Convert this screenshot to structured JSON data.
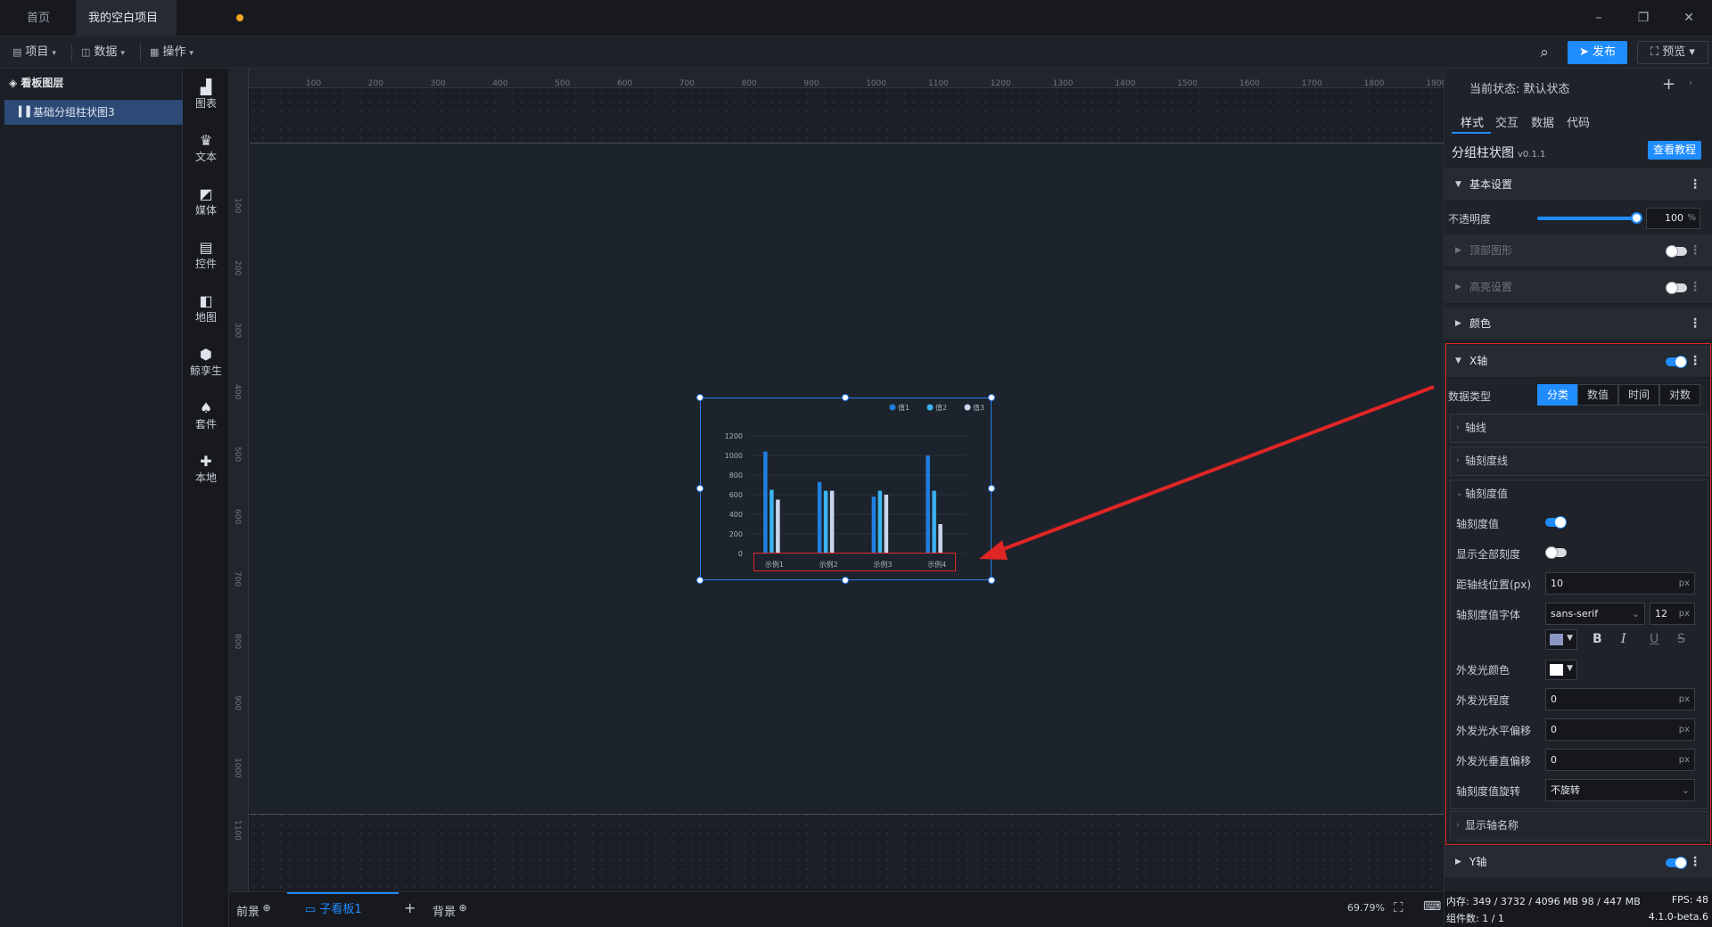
{
  "tabs": {
    "home": "首页",
    "project": "我的空白项目"
  },
  "menubar": {
    "project": "项目",
    "data": "数据",
    "operation": "操作",
    "publish": "发布",
    "preview": "预览"
  },
  "layers": {
    "title": "看板图层",
    "item": "基础分组柱状图3"
  },
  "toolbox": [
    "图表",
    "文本",
    "媒体",
    "控件",
    "地图",
    "鲸孪生",
    "套件",
    "本地"
  ],
  "ruler": {
    "top": [
      "100",
      "200",
      "300",
      "400",
      "500",
      "600",
      "700",
      "800",
      "900",
      "1000",
      "1100",
      "1200",
      "1300",
      "1400",
      "1500",
      "1600",
      "1700",
      "1800",
      "1900"
    ],
    "left": [
      "100",
      "200",
      "300",
      "400",
      "500",
      "600",
      "700",
      "800",
      "900",
      "1000",
      "1100"
    ]
  },
  "chart_data": {
    "type": "bar",
    "categories": [
      "示例1",
      "示例2",
      "示例3",
      "示例4"
    ],
    "series": [
      {
        "name": "值1",
        "values": [
          1040,
          730,
          580,
          1000
        ],
        "color": "#1f7fe0"
      },
      {
        "name": "值2",
        "values": [
          650,
          640,
          640,
          640
        ],
        "color": "#3bb3f0"
      },
      {
        "name": "值3",
        "values": [
          550,
          640,
          600,
          300
        ],
        "color": "#c9d6ee"
      }
    ],
    "ylim": [
      0,
      1200
    ],
    "yticks": [
      "0",
      "200",
      "400",
      "600",
      "800",
      "1000",
      "1200"
    ],
    "legend": "top-right",
    "grid": true
  },
  "bottom": {
    "foreground": "前景",
    "board": "子看板1",
    "background": "背景",
    "zoom": "69.79%"
  },
  "props": {
    "state_label": "当前状态: 默认状态",
    "tabs": [
      "样式",
      "交互",
      "数据",
      "代码"
    ],
    "component": "分组柱状图",
    "version": "v0.1.1",
    "tutorial": "查看教程",
    "sections": {
      "basic": "基本设置",
      "top_shape": "顶部图形",
      "highlight": "高亮设置",
      "color": "颜色",
      "xaxis": "X轴",
      "yaxis": "Y轴"
    },
    "opacity": {
      "label": "不透明度",
      "value": "100",
      "unit": "%",
      "level": 100
    },
    "data_type": {
      "label": "数据类型",
      "options": [
        "分类",
        "数值",
        "时间",
        "对数"
      ],
      "selected": "分类"
    },
    "subs": {
      "axis_line": "轴线",
      "tick_line": "轴刻度线",
      "tick_value": "轴刻度值",
      "axis_name": "显示轴名称"
    },
    "rows": {
      "tick_value": "轴刻度值",
      "show_all": "显示全部刻度",
      "distance": "距轴线位置(px)",
      "distance_value": "10",
      "font": "轴刻度值字体",
      "font_family": "sans-serif",
      "font_size": "12",
      "glow_color": "外发光颜色",
      "glow_degree": "外发光程度",
      "glow_degree_value": "0",
      "glow_h": "外发光水平偏移",
      "glow_h_value": "0",
      "glow_v": "外发光垂直偏移",
      "glow_v_value": "0",
      "rotate": "轴刻度值旋转",
      "rotate_value": "不旋转",
      "unit": "px"
    },
    "font_color": "#8c96c4",
    "glow_swatch": "#ffffff"
  },
  "status": {
    "memory": "内存: 349 / 3732 / 4096 MB  98 / 447 MB",
    "fps": "FPS: 48",
    "count": "组件数: 1 / 1",
    "version": "4.1.0-beta.6"
  }
}
